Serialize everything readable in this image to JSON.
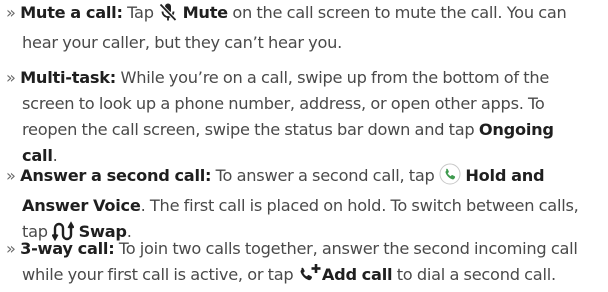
{
  "bullet_marker": "»",
  "items": [
    {
      "lead": "Mute a call:",
      "l1_a": " Tap ",
      "icon1": "muted-microphone-icon",
      "b1": "Mute",
      "l1_b": " on the call screen to mute the call. You can",
      "l2": "hear your caller, but they can’t hear you."
    },
    {
      "lead": "Multi-task:",
      "l1": " While you’re on a call, swipe up from the bottom of the",
      "l2": "screen to look up a phone number, address, or open other apps. To",
      "l3_a": "reopen the call screen, swipe the status bar down and tap ",
      "b1": "Ongoing",
      "b2": "call",
      "l4_end": "."
    },
    {
      "lead": "Answer a second call:",
      "l1_a": " To answer a second call, tap ",
      "icon1": "phone-circle-icon",
      "b1": "Hold and",
      "b2": "Answer Voice",
      "l2_b": ". The first call is placed on hold. To switch between calls,",
      "l3_a": "tap ",
      "icon2": "swap-arrows-icon",
      "b3": "Swap",
      "l3_end": "."
    },
    {
      "lead": "3-way call:",
      "l1": " To join two calls together, answer the second incoming call",
      "l2_a": "while your first call is active, or tap ",
      "icon1": "add-call-icon",
      "b1": "Add call",
      "l2_b": " to dial a second call."
    }
  ],
  "colors": {
    "text": "#4a4a4a",
    "bold": "#1f1f1f",
    "phone_icon": "#3f9a4f"
  }
}
